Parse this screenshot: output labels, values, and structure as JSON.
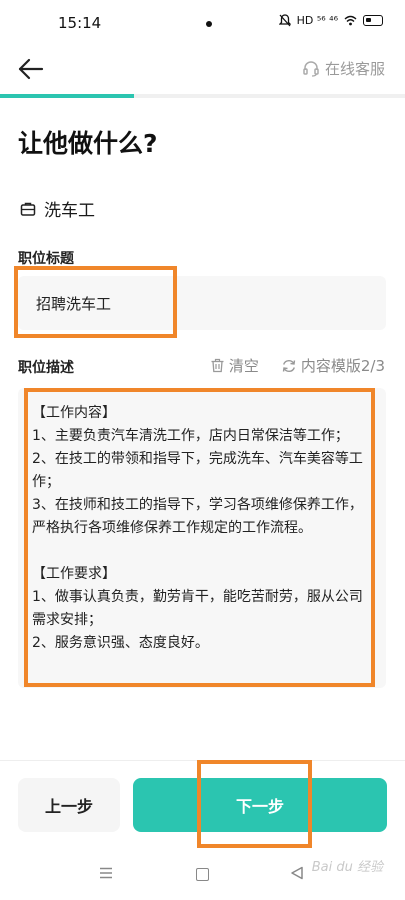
{
  "status_bar": {
    "time": "15:14",
    "icons_text": "HD ⁵⁶ ⁴⁶"
  },
  "header": {
    "support_label": "在线客服",
    "progress_fraction": 0.33
  },
  "page": {
    "title": "让他做什么?",
    "job_type": "洗车工"
  },
  "form": {
    "title_label": "职位标题",
    "title_value": "招聘洗车工",
    "desc_label": "职位描述",
    "clear_label": "清空",
    "template_label": "内容模版2/3",
    "description": "【工作内容】\n1、主要负责汽车清洗工作，店内日常保洁等工作；\n2、在技工的带领和指导下，完成洗车、汽车美容等工作；\n3、在技师和技工的指导下，学习各项维修保养工作，严格执行各项维修保养工作规定的工作流程。\n\n【工作要求】\n1、做事认真负责，勤劳肯干，能吃苦耐劳，服从公司需求安排；\n2、服务意识强、态度良好。"
  },
  "footer": {
    "prev_label": "上一步",
    "next_label": "下一步"
  },
  "watermark": "Bai du 经验",
  "colors": {
    "accent": "#2bc5b0",
    "highlight": "#f0862a"
  }
}
